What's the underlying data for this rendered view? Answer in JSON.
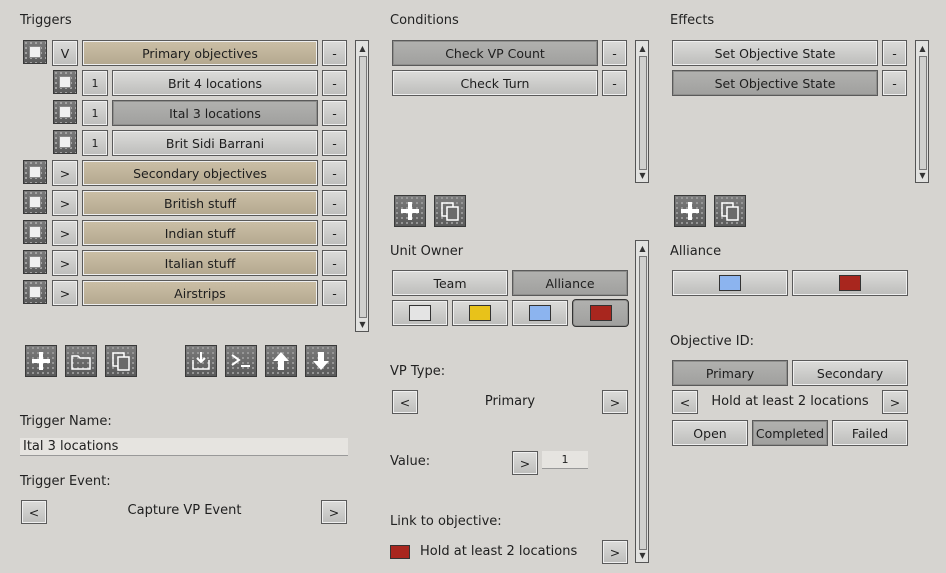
{
  "triggers": {
    "header": "Triggers",
    "rows": [
      {
        "toggle": "V",
        "label": "Primary objectives",
        "tan": true,
        "indent": false
      },
      {
        "toggle": "1",
        "label": "Brit 4 locations",
        "tan": false,
        "indent": true,
        "dark": false
      },
      {
        "toggle": "1",
        "label": "Ital 3 locations",
        "tan": false,
        "indent": true,
        "dark": true
      },
      {
        "toggle": "1",
        "label": "Brit Sidi Barrani",
        "tan": false,
        "indent": true,
        "dark": false
      },
      {
        "toggle": ">",
        "label": "Secondary objectives",
        "tan": true,
        "indent": false
      },
      {
        "toggle": ">",
        "label": "British stuff",
        "tan": true,
        "indent": false
      },
      {
        "toggle": ">",
        "label": "Indian stuff",
        "tan": true,
        "indent": false
      },
      {
        "toggle": ">",
        "label": "Italian stuff",
        "tan": true,
        "indent": false
      },
      {
        "toggle": ">",
        "label": "Airstrips",
        "tan": true,
        "indent": false
      }
    ],
    "remove_label": "-",
    "trigger_name_label": "Trigger Name:",
    "trigger_name_value": "Ital 3 locations",
    "trigger_event_label": "Trigger Event:",
    "trigger_event_value": "Capture VP Event",
    "prev": "<",
    "next": ">"
  },
  "conditions": {
    "header": "Conditions",
    "rows": [
      "Check VP Count",
      "Check Turn"
    ],
    "remove_label": "-",
    "unit_owner_label": "Unit Owner",
    "team_label": "Team",
    "alliance_label": "Alliance",
    "vp_type_label": "VP Type:",
    "vp_type_value": "Primary",
    "value_label": "Value:",
    "value_value": "1",
    "link_label": "Link to objective:",
    "link_value": "Hold at least 2 locations",
    "prev": "<",
    "next": ">"
  },
  "effects": {
    "header": "Effects",
    "rows": [
      "Set Objective State",
      "Set Objective State"
    ],
    "remove_label": "-",
    "alliance_label": "Alliance",
    "objective_id_label": "Objective ID:",
    "primary_label": "Primary",
    "secondary_label": "Secondary",
    "objective_value": "Hold at least 2 locations",
    "open_label": "Open",
    "completed_label": "Completed",
    "failed_label": "Failed",
    "prev": "<",
    "next": ">"
  },
  "colors": {
    "white": "#e4e4e4",
    "yellow": "#e8c21a",
    "blue": "#8cb4ef",
    "red": "#a8261e"
  }
}
